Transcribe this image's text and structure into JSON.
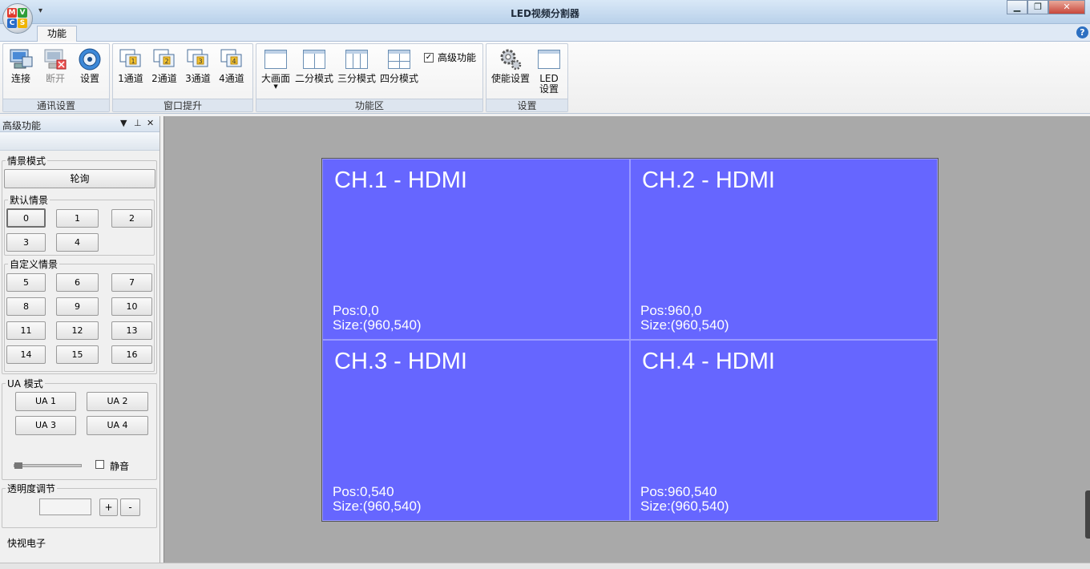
{
  "window": {
    "title": "LED视频分割器",
    "controls": {
      "minimize": "▁",
      "maximize": "❐",
      "close": "✕"
    }
  },
  "ribbon": {
    "tabs": [
      "功能"
    ],
    "groups": {
      "comm": {
        "label": "通讯设置",
        "buttons": {
          "connect": "连接",
          "disconnect": "断开",
          "settings": "设置"
        }
      },
      "window_raise": {
        "label": "窗口提升",
        "buttons": [
          "1通道",
          "2通道",
          "3通道",
          "4通道"
        ]
      },
      "function_area": {
        "label": "功能区",
        "buttons": {
          "big": "大画面",
          "two": "二分模式",
          "three": "三分模式",
          "four": "四分模式"
        },
        "advanced_checkbox": {
          "label": "高级功能",
          "checked": true
        }
      },
      "setup": {
        "label": "设置",
        "buttons": {
          "enable": "使能设置",
          "led_line1": "LED",
          "led_line2": "设置"
        }
      }
    }
  },
  "panel": {
    "title": "高级功能",
    "scene_mode": {
      "legend": "情景模式",
      "poll_button": "轮询",
      "default": {
        "legend": "默认情景",
        "buttons": [
          "0",
          "1",
          "2",
          "3",
          "4"
        ]
      },
      "custom": {
        "legend": "自定义情景",
        "buttons": [
          "5",
          "6",
          "7",
          "8",
          "9",
          "10",
          "11",
          "12",
          "13",
          "14",
          "15",
          "16"
        ]
      }
    },
    "ua_mode": {
      "legend": "UA 模式",
      "buttons": [
        "UA 1",
        "UA 2",
        "UA 3",
        "UA 4"
      ],
      "mute_label": "静音",
      "mute_checked": false,
      "volume": 0
    },
    "opacity": {
      "legend": "透明度调节",
      "value": "",
      "plus": "+",
      "minus": "-"
    },
    "footer": "快视电子"
  },
  "channels": [
    {
      "name": "CH.1 - HDMI",
      "pos": "Pos:0,0",
      "size": "Size:(960,540)"
    },
    {
      "name": "CH.2 - HDMI",
      "pos": "Pos:960,0",
      "size": "Size:(960,540)"
    },
    {
      "name": "CH.3 - HDMI",
      "pos": "Pos:0,540",
      "size": "Size:(960,540)"
    },
    {
      "name": "CH.4 - HDMI",
      "pos": "Pos:960,540",
      "size": "Size:(960,540)"
    }
  ],
  "colors": {
    "channel_fill": "#6666ff",
    "workspace": "#a9a9a9"
  }
}
